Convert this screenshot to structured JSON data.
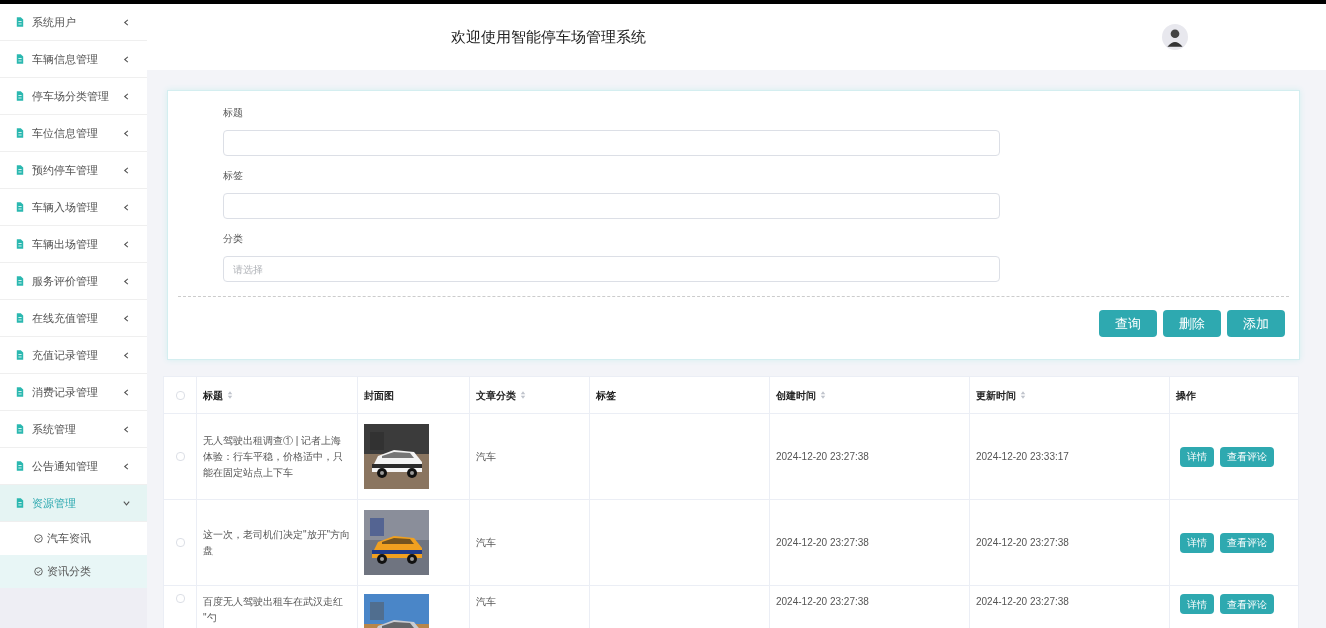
{
  "sidebar": {
    "items": [
      {
        "label": "系统用户",
        "expanded": false
      },
      {
        "label": "车辆信息管理",
        "expanded": false
      },
      {
        "label": "停车场分类管理",
        "expanded": false
      },
      {
        "label": "车位信息管理",
        "expanded": false
      },
      {
        "label": "预约停车管理",
        "expanded": false
      },
      {
        "label": "车辆入场管理",
        "expanded": false
      },
      {
        "label": "车辆出场管理",
        "expanded": false
      },
      {
        "label": "服务评价管理",
        "expanded": false
      },
      {
        "label": "在线充值管理",
        "expanded": false
      },
      {
        "label": "充值记录管理",
        "expanded": false
      },
      {
        "label": "消费记录管理",
        "expanded": false
      },
      {
        "label": "系统管理",
        "expanded": false
      },
      {
        "label": "公告通知管理",
        "expanded": false
      },
      {
        "label": "资源管理",
        "expanded": true,
        "children": [
          {
            "label": "汽车资讯",
            "selected": false
          },
          {
            "label": "资讯分类",
            "selected": true
          }
        ]
      }
    ]
  },
  "header": {
    "title": "欢迎使用智能停车场管理系统"
  },
  "search_form": {
    "fields": [
      {
        "label": "标题",
        "kind": "text"
      },
      {
        "label": "标签",
        "kind": "text"
      },
      {
        "label": "分类",
        "kind": "select",
        "placeholder": "请选择"
      }
    ],
    "buttons": [
      "查询",
      "删除",
      "添加"
    ]
  },
  "table": {
    "select_all_checked": false,
    "columns": [
      {
        "label": "标题",
        "sortable": true
      },
      {
        "label": "封面图",
        "sortable": false
      },
      {
        "label": "文章分类",
        "sortable": true
      },
      {
        "label": "标签",
        "sortable": false
      },
      {
        "label": "创建时间",
        "sortable": true
      },
      {
        "label": "更新时间",
        "sortable": true
      },
      {
        "label": "操作",
        "sortable": false
      }
    ],
    "rows": [
      {
        "checked": false,
        "title": "无人驾驶出租调查① | 记者上海体验：行车平稳，价格适中，只能在固定站点上下车",
        "category": "汽车",
        "created": "2024-12-20 23:27:38",
        "updated": "2024-12-20 23:33:17",
        "actions": [
          "详情",
          "查看评论"
        ]
      },
      {
        "checked": false,
        "title": "这一次，老司机们决定\"放开\"方向盘",
        "category": "汽车",
        "created": "2024-12-20 23:27:38",
        "updated": "2024-12-20 23:27:38",
        "actions": [
          "详情",
          "查看评论"
        ]
      },
      {
        "checked": false,
        "title": "百度无人驾驶出租车在武汉走红 \"勺",
        "category": "汽车",
        "created": "2024-12-20 23:27:38",
        "updated": "2024-12-20 23:27:38",
        "actions": [
          "详情",
          "查看评论"
        ]
      }
    ]
  }
}
